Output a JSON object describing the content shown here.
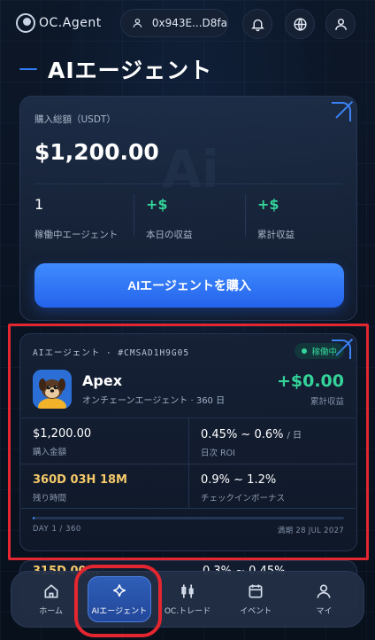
{
  "header": {
    "logo_text": "OC.Agent",
    "wallet_address": "0x943E...D8fa"
  },
  "page": {
    "title": "AIエージェント"
  },
  "summary": {
    "total_label": "購入総額（USDT）",
    "total_value": "$1,200.00",
    "watermark": "Ai",
    "stats": [
      {
        "value": "1",
        "label": "稼働中エージェント"
      },
      {
        "value": "+$",
        "label": "本日の収益"
      },
      {
        "value": "+$",
        "label": "累計収益"
      }
    ],
    "buy_button": "AIエージェントを購入"
  },
  "agent_card": {
    "header": "AIエージェント · #CMSAD1H9G05",
    "status": "稼働中",
    "name": "Apex",
    "subtitle": "オンチェーンエージェント · 360 日",
    "profit": "+$0.00",
    "profit_label": "累計収益",
    "purchase_amount": "$1,200.00",
    "purchase_amount_label": "購入金額",
    "daily_roi": "0.45% ~ 0.6%",
    "daily_roi_unit": "/ 日",
    "daily_roi_label": "日次 ROI",
    "remaining_time": "360D 03H 18M",
    "remaining_time_label": "残り時間",
    "checkin_bonus": "0.9% ~ 1.2%",
    "checkin_bonus_label": "チェックインボーナス",
    "progress_fraction": 0.003,
    "day_progress": "DAY 1 / 360",
    "expire": "満期 28 JUL 2027"
  },
  "next_card_peek": {
    "left": "315D 00...",
    "right": "0.3% ~ 0.45%"
  },
  "nav": {
    "items": [
      {
        "label": "ホーム",
        "icon": "home-icon"
      },
      {
        "label": "AIエージェント",
        "icon": "sparkle-icon"
      },
      {
        "label": "OC.トレード",
        "icon": "candlestick-icon"
      },
      {
        "label": "イベント",
        "icon": "calendar-icon"
      },
      {
        "label": "マイ",
        "icon": "user-icon"
      }
    ]
  },
  "colors": {
    "accent": "#3b82f6",
    "positive": "#34d399",
    "gold": "#f5c96a",
    "highlight": "#e3262f"
  }
}
